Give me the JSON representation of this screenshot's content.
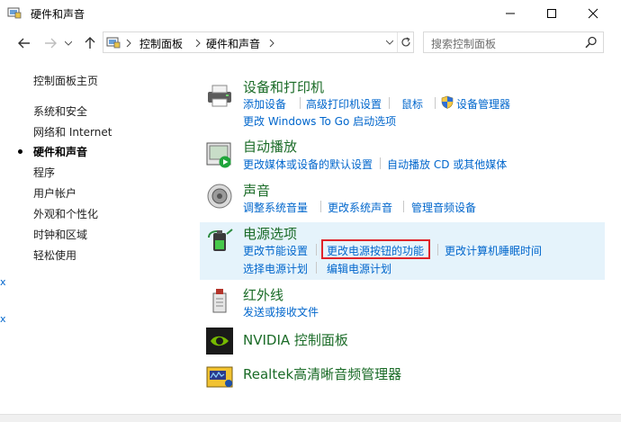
{
  "window": {
    "title": "硬件和声音"
  },
  "address": {
    "segments": [
      "控制面板",
      "硬件和声音"
    ]
  },
  "search": {
    "placeholder": "搜索控制面板"
  },
  "sidebar": {
    "home": "控制面板主页",
    "items": [
      "系统和安全",
      "网络和 Internet",
      "硬件和声音",
      "程序",
      "用户帐户",
      "外观和个性化",
      "时钟和区域",
      "轻松使用"
    ],
    "active_index": 2
  },
  "categories": [
    {
      "title": "设备和打印机",
      "icon": "printer-icon",
      "links": [
        [
          "添加设备",
          "高级打印机设置",
          "鼠标",
          "设备管理器"
        ],
        [
          "更改 Windows To Go 启动选项"
        ]
      ]
    },
    {
      "title": "自动播放",
      "icon": "autoplay-icon",
      "links": [
        [
          "更改媒体或设备的默认设置",
          "自动播放 CD 或其他媒体"
        ]
      ]
    },
    {
      "title": "声音",
      "icon": "speaker-icon",
      "links": [
        [
          "调整系统音量",
          "更改系统声音",
          "管理音频设备"
        ]
      ]
    },
    {
      "title": "电源选项",
      "icon": "battery-icon",
      "links": [
        [
          "更改节能设置",
          "更改电源按钮的功能",
          "更改计算机睡眠时间"
        ],
        [
          "选择电源计划",
          "编辑电源计划"
        ]
      ]
    },
    {
      "title": "红外线",
      "icon": "infrared-icon",
      "links": [
        [
          "发送或接收文件"
        ]
      ]
    },
    {
      "title": "NVIDIA 控制面板",
      "icon": "nvidia-icon",
      "links": []
    },
    {
      "title": "Realtek高清晰音频管理器",
      "icon": "realtek-icon",
      "links": []
    }
  ],
  "left_edge_fragments": [
    "x",
    "x"
  ],
  "colors": {
    "link": "#0066cc",
    "category_title": "#1a6b27",
    "highlight": "#e5f3fb",
    "red_box": "#e0242a"
  }
}
